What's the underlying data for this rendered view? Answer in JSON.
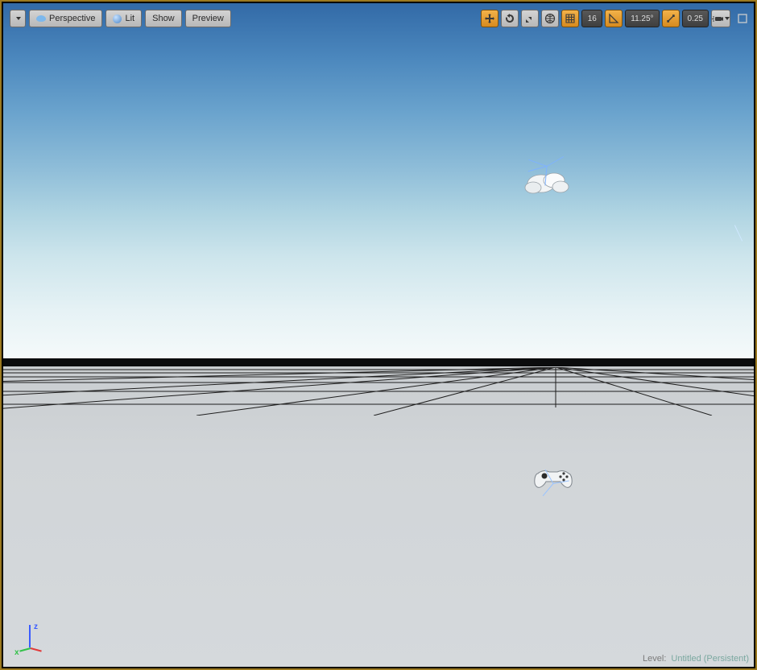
{
  "toolbar": {
    "view_mode": "Perspective",
    "lit_mode": "Lit",
    "show_label": "Show",
    "preview_label": "Preview"
  },
  "snap": {
    "grid_value": "16",
    "angle_value": "11.25°",
    "scale_value": "0.25"
  },
  "status": {
    "label": "Level:",
    "level_name": "Untitled (Persistent)"
  },
  "axis": {
    "z": "z",
    "x": "x"
  }
}
